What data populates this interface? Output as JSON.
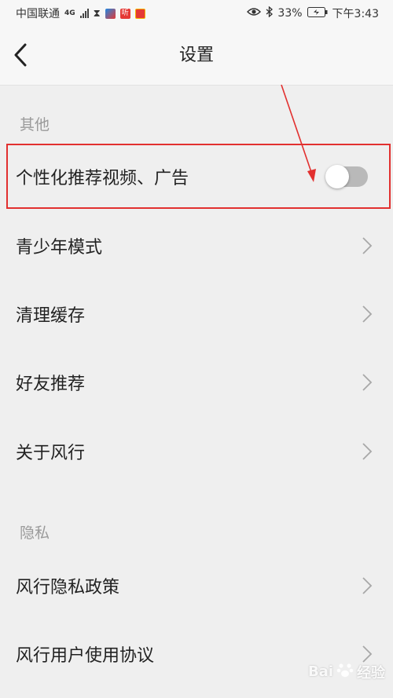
{
  "status_bar": {
    "carrier": "中国联通",
    "network": "4G",
    "app_badge_text": "听",
    "battery": "33%",
    "time": "下午3:43"
  },
  "nav": {
    "title": "设置"
  },
  "sections": {
    "other": {
      "label": "其他",
      "items": [
        {
          "label": "个性化推荐视频、广告",
          "control": "toggle",
          "toggle_on": false
        },
        {
          "label": "青少年模式",
          "control": "chevron"
        },
        {
          "label": "清理缓存",
          "control": "chevron"
        },
        {
          "label": "好友推荐",
          "control": "chevron"
        },
        {
          "label": "关于风行",
          "control": "chevron"
        }
      ]
    },
    "privacy": {
      "label": "隐私",
      "items": [
        {
          "label": "风行隐私政策",
          "control": "chevron"
        },
        {
          "label": "风行用户使用协议",
          "control": "chevron"
        }
      ]
    }
  },
  "watermark": {
    "brand": "Bai",
    "text": "经验"
  },
  "colors": {
    "highlight": "#e2302f",
    "toggle_off_track": "#b9b9b9",
    "background": "#efefef"
  }
}
